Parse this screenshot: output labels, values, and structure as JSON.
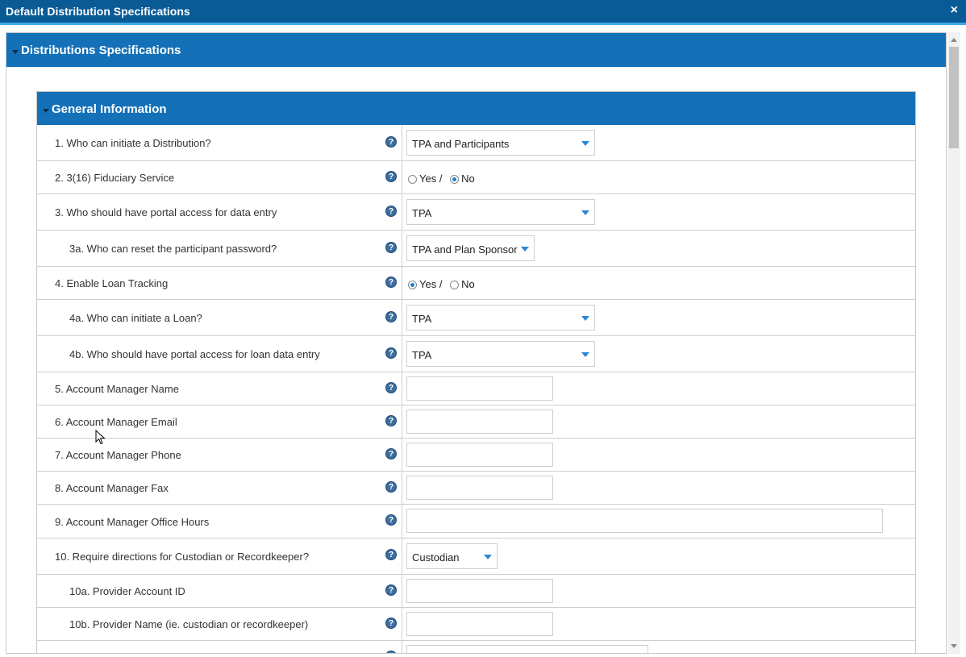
{
  "dialog": {
    "title": "Default Distribution Specifications",
    "close_symbol": "×"
  },
  "section": {
    "title": "Distributions Specifications"
  },
  "panel": {
    "title": "General Information"
  },
  "help_symbol": "?",
  "rows": [
    {
      "label": "1. Who can initiate a Distribution?",
      "control": "select",
      "value": "TPA and Participants"
    },
    {
      "label": "2. 3(16) Fiduciary Service",
      "control": "radio",
      "option_yes": "Yes /",
      "option_no": "No",
      "selected": "No"
    },
    {
      "label": "3. Who should have portal access for data entry",
      "control": "select",
      "value": "TPA"
    },
    {
      "label": "3a. Who can reset the participant password?",
      "control": "select",
      "value": "TPA and Plan Sponsor"
    },
    {
      "label": "4. Enable Loan Tracking",
      "control": "radio",
      "option_yes": "Yes /",
      "option_no": "No",
      "selected": "Yes"
    },
    {
      "label": "4a. Who can initiate a Loan?",
      "control": "select",
      "value": "TPA"
    },
    {
      "label": "4b. Who should have portal access for loan data entry",
      "control": "select",
      "value": "TPA"
    },
    {
      "label": "5. Account Manager Name",
      "control": "text",
      "value": ""
    },
    {
      "label": "6. Account Manager Email",
      "control": "text",
      "value": ""
    },
    {
      "label": "7. Account Manager Phone",
      "control": "text",
      "value": ""
    },
    {
      "label": "8. Account Manager Fax",
      "control": "text",
      "value": ""
    },
    {
      "label": "9. Account Manager Office Hours",
      "control": "text",
      "value": ""
    },
    {
      "label": "10. Require directions for Custodian or Recordkeeper?",
      "control": "select",
      "value": "Custodian"
    },
    {
      "label": "10a. Provider Account ID",
      "control": "text",
      "value": ""
    },
    {
      "label": "10b. Provider Name (ie. custodian or recordkeeper)",
      "control": "text",
      "value": ""
    }
  ]
}
